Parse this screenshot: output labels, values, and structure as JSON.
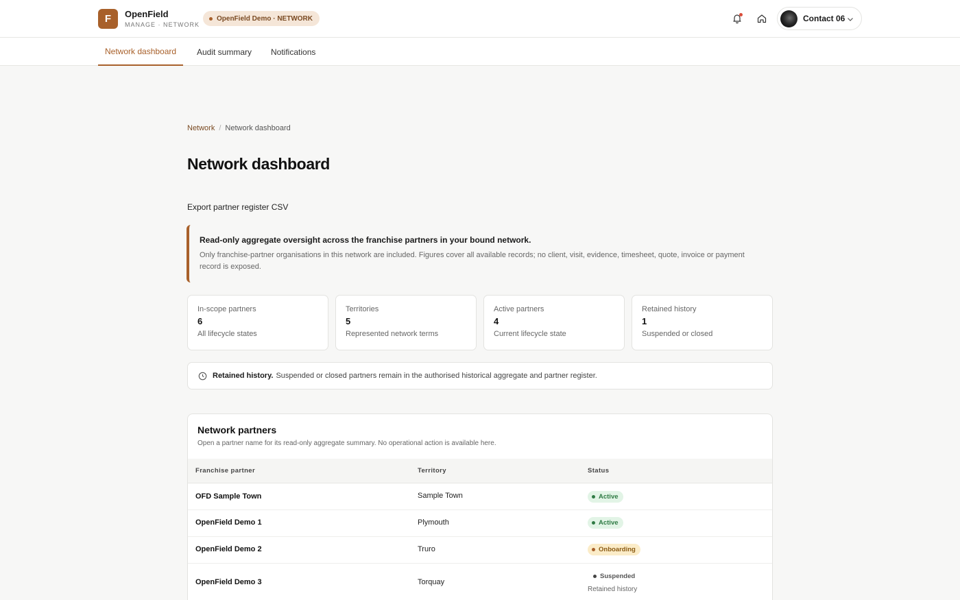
{
  "header": {
    "logo_letter": "F",
    "brand_name": "OpenField",
    "brand_sub": "MANAGE · NETWORK",
    "env_label": "OpenField Demo · NETWORK",
    "user_name": "Contact 06"
  },
  "tabs": [
    {
      "label": "Network dashboard",
      "active": true
    },
    {
      "label": "Audit summary",
      "active": false
    },
    {
      "label": "Notifications",
      "active": false
    }
  ],
  "breadcrumb": {
    "root": "Network",
    "current": "Network dashboard"
  },
  "page": {
    "title": "Network dashboard",
    "export_label": "Export partner register CSV"
  },
  "callout": {
    "title": "Read-only aggregate oversight across the franchise partners in your bound network.",
    "body": "Only franchise-partner organisations in this network are included. Figures cover all available records; no client, visit, evidence, timesheet, quote, invoice or payment record is exposed."
  },
  "stats": [
    {
      "label": "In-scope partners",
      "value": "6",
      "sub": "All lifecycle states"
    },
    {
      "label": "Territories",
      "value": "5",
      "sub": "Represented network terms"
    },
    {
      "label": "Active partners",
      "value": "4",
      "sub": "Current lifecycle state"
    },
    {
      "label": "Retained history",
      "value": "1",
      "sub": "Suspended or closed"
    }
  ],
  "note": {
    "bold": "Retained history.",
    "text": "Suspended or closed partners remain in the authorised historical aggregate and partner register."
  },
  "partners": {
    "title": "Network partners",
    "subtitle": "Open a partner name for its read-only aggregate summary. No operational action is available here.",
    "columns": [
      "Franchise partner",
      "Territory",
      "Status"
    ],
    "rows": [
      {
        "name": "OFD Sample Town",
        "territory": "Sample Town",
        "status": "Active",
        "note": ""
      },
      {
        "name": "OpenField Demo 1",
        "territory": "Plymouth",
        "status": "Active",
        "note": ""
      },
      {
        "name": "OpenField Demo 2",
        "territory": "Truro",
        "status": "Onboarding",
        "note": ""
      },
      {
        "name": "OpenField Demo 3",
        "territory": "Torquay",
        "status": "Suspended",
        "note": "Retained history"
      }
    ]
  },
  "colors": {
    "accent": "#a8602a",
    "active_bg": "#e2f4e6",
    "active_text": "#2f7a44",
    "onboarding_bg": "#fbecc8",
    "onboarding_text": "#8a5a12"
  },
  "icons": [
    "bell-icon",
    "home-icon",
    "chevron-down-icon",
    "clock-icon"
  ]
}
